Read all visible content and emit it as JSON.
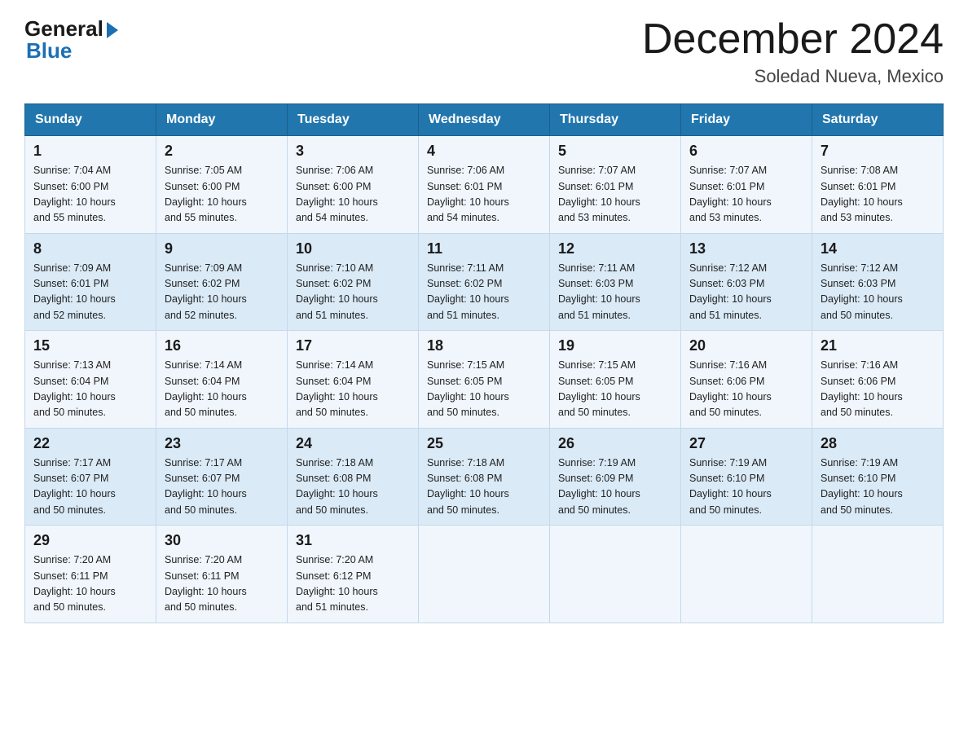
{
  "header": {
    "logo_general": "General",
    "logo_blue": "Blue",
    "month_title": "December 2024",
    "location": "Soledad Nueva, Mexico"
  },
  "days_of_week": [
    "Sunday",
    "Monday",
    "Tuesday",
    "Wednesday",
    "Thursday",
    "Friday",
    "Saturday"
  ],
  "weeks": [
    [
      {
        "day": "1",
        "sunrise": "7:04 AM",
        "sunset": "6:00 PM",
        "daylight": "10 hours and 55 minutes."
      },
      {
        "day": "2",
        "sunrise": "7:05 AM",
        "sunset": "6:00 PM",
        "daylight": "10 hours and 55 minutes."
      },
      {
        "day": "3",
        "sunrise": "7:06 AM",
        "sunset": "6:00 PM",
        "daylight": "10 hours and 54 minutes."
      },
      {
        "day": "4",
        "sunrise": "7:06 AM",
        "sunset": "6:01 PM",
        "daylight": "10 hours and 54 minutes."
      },
      {
        "day": "5",
        "sunrise": "7:07 AM",
        "sunset": "6:01 PM",
        "daylight": "10 hours and 53 minutes."
      },
      {
        "day": "6",
        "sunrise": "7:07 AM",
        "sunset": "6:01 PM",
        "daylight": "10 hours and 53 minutes."
      },
      {
        "day": "7",
        "sunrise": "7:08 AM",
        "sunset": "6:01 PM",
        "daylight": "10 hours and 53 minutes."
      }
    ],
    [
      {
        "day": "8",
        "sunrise": "7:09 AM",
        "sunset": "6:01 PM",
        "daylight": "10 hours and 52 minutes."
      },
      {
        "day": "9",
        "sunrise": "7:09 AM",
        "sunset": "6:02 PM",
        "daylight": "10 hours and 52 minutes."
      },
      {
        "day": "10",
        "sunrise": "7:10 AM",
        "sunset": "6:02 PM",
        "daylight": "10 hours and 51 minutes."
      },
      {
        "day": "11",
        "sunrise": "7:11 AM",
        "sunset": "6:02 PM",
        "daylight": "10 hours and 51 minutes."
      },
      {
        "day": "12",
        "sunrise": "7:11 AM",
        "sunset": "6:03 PM",
        "daylight": "10 hours and 51 minutes."
      },
      {
        "day": "13",
        "sunrise": "7:12 AM",
        "sunset": "6:03 PM",
        "daylight": "10 hours and 51 minutes."
      },
      {
        "day": "14",
        "sunrise": "7:12 AM",
        "sunset": "6:03 PM",
        "daylight": "10 hours and 50 minutes."
      }
    ],
    [
      {
        "day": "15",
        "sunrise": "7:13 AM",
        "sunset": "6:04 PM",
        "daylight": "10 hours and 50 minutes."
      },
      {
        "day": "16",
        "sunrise": "7:14 AM",
        "sunset": "6:04 PM",
        "daylight": "10 hours and 50 minutes."
      },
      {
        "day": "17",
        "sunrise": "7:14 AM",
        "sunset": "6:04 PM",
        "daylight": "10 hours and 50 minutes."
      },
      {
        "day": "18",
        "sunrise": "7:15 AM",
        "sunset": "6:05 PM",
        "daylight": "10 hours and 50 minutes."
      },
      {
        "day": "19",
        "sunrise": "7:15 AM",
        "sunset": "6:05 PM",
        "daylight": "10 hours and 50 minutes."
      },
      {
        "day": "20",
        "sunrise": "7:16 AM",
        "sunset": "6:06 PM",
        "daylight": "10 hours and 50 minutes."
      },
      {
        "day": "21",
        "sunrise": "7:16 AM",
        "sunset": "6:06 PM",
        "daylight": "10 hours and 50 minutes."
      }
    ],
    [
      {
        "day": "22",
        "sunrise": "7:17 AM",
        "sunset": "6:07 PM",
        "daylight": "10 hours and 50 minutes."
      },
      {
        "day": "23",
        "sunrise": "7:17 AM",
        "sunset": "6:07 PM",
        "daylight": "10 hours and 50 minutes."
      },
      {
        "day": "24",
        "sunrise": "7:18 AM",
        "sunset": "6:08 PM",
        "daylight": "10 hours and 50 minutes."
      },
      {
        "day": "25",
        "sunrise": "7:18 AM",
        "sunset": "6:08 PM",
        "daylight": "10 hours and 50 minutes."
      },
      {
        "day": "26",
        "sunrise": "7:19 AM",
        "sunset": "6:09 PM",
        "daylight": "10 hours and 50 minutes."
      },
      {
        "day": "27",
        "sunrise": "7:19 AM",
        "sunset": "6:10 PM",
        "daylight": "10 hours and 50 minutes."
      },
      {
        "day": "28",
        "sunrise": "7:19 AM",
        "sunset": "6:10 PM",
        "daylight": "10 hours and 50 minutes."
      }
    ],
    [
      {
        "day": "29",
        "sunrise": "7:20 AM",
        "sunset": "6:11 PM",
        "daylight": "10 hours and 50 minutes."
      },
      {
        "day": "30",
        "sunrise": "7:20 AM",
        "sunset": "6:11 PM",
        "daylight": "10 hours and 50 minutes."
      },
      {
        "day": "31",
        "sunrise": "7:20 AM",
        "sunset": "6:12 PM",
        "daylight": "10 hours and 51 minutes."
      },
      null,
      null,
      null,
      null
    ]
  ],
  "labels": {
    "sunrise": "Sunrise:",
    "sunset": "Sunset:",
    "daylight": "Daylight:"
  }
}
